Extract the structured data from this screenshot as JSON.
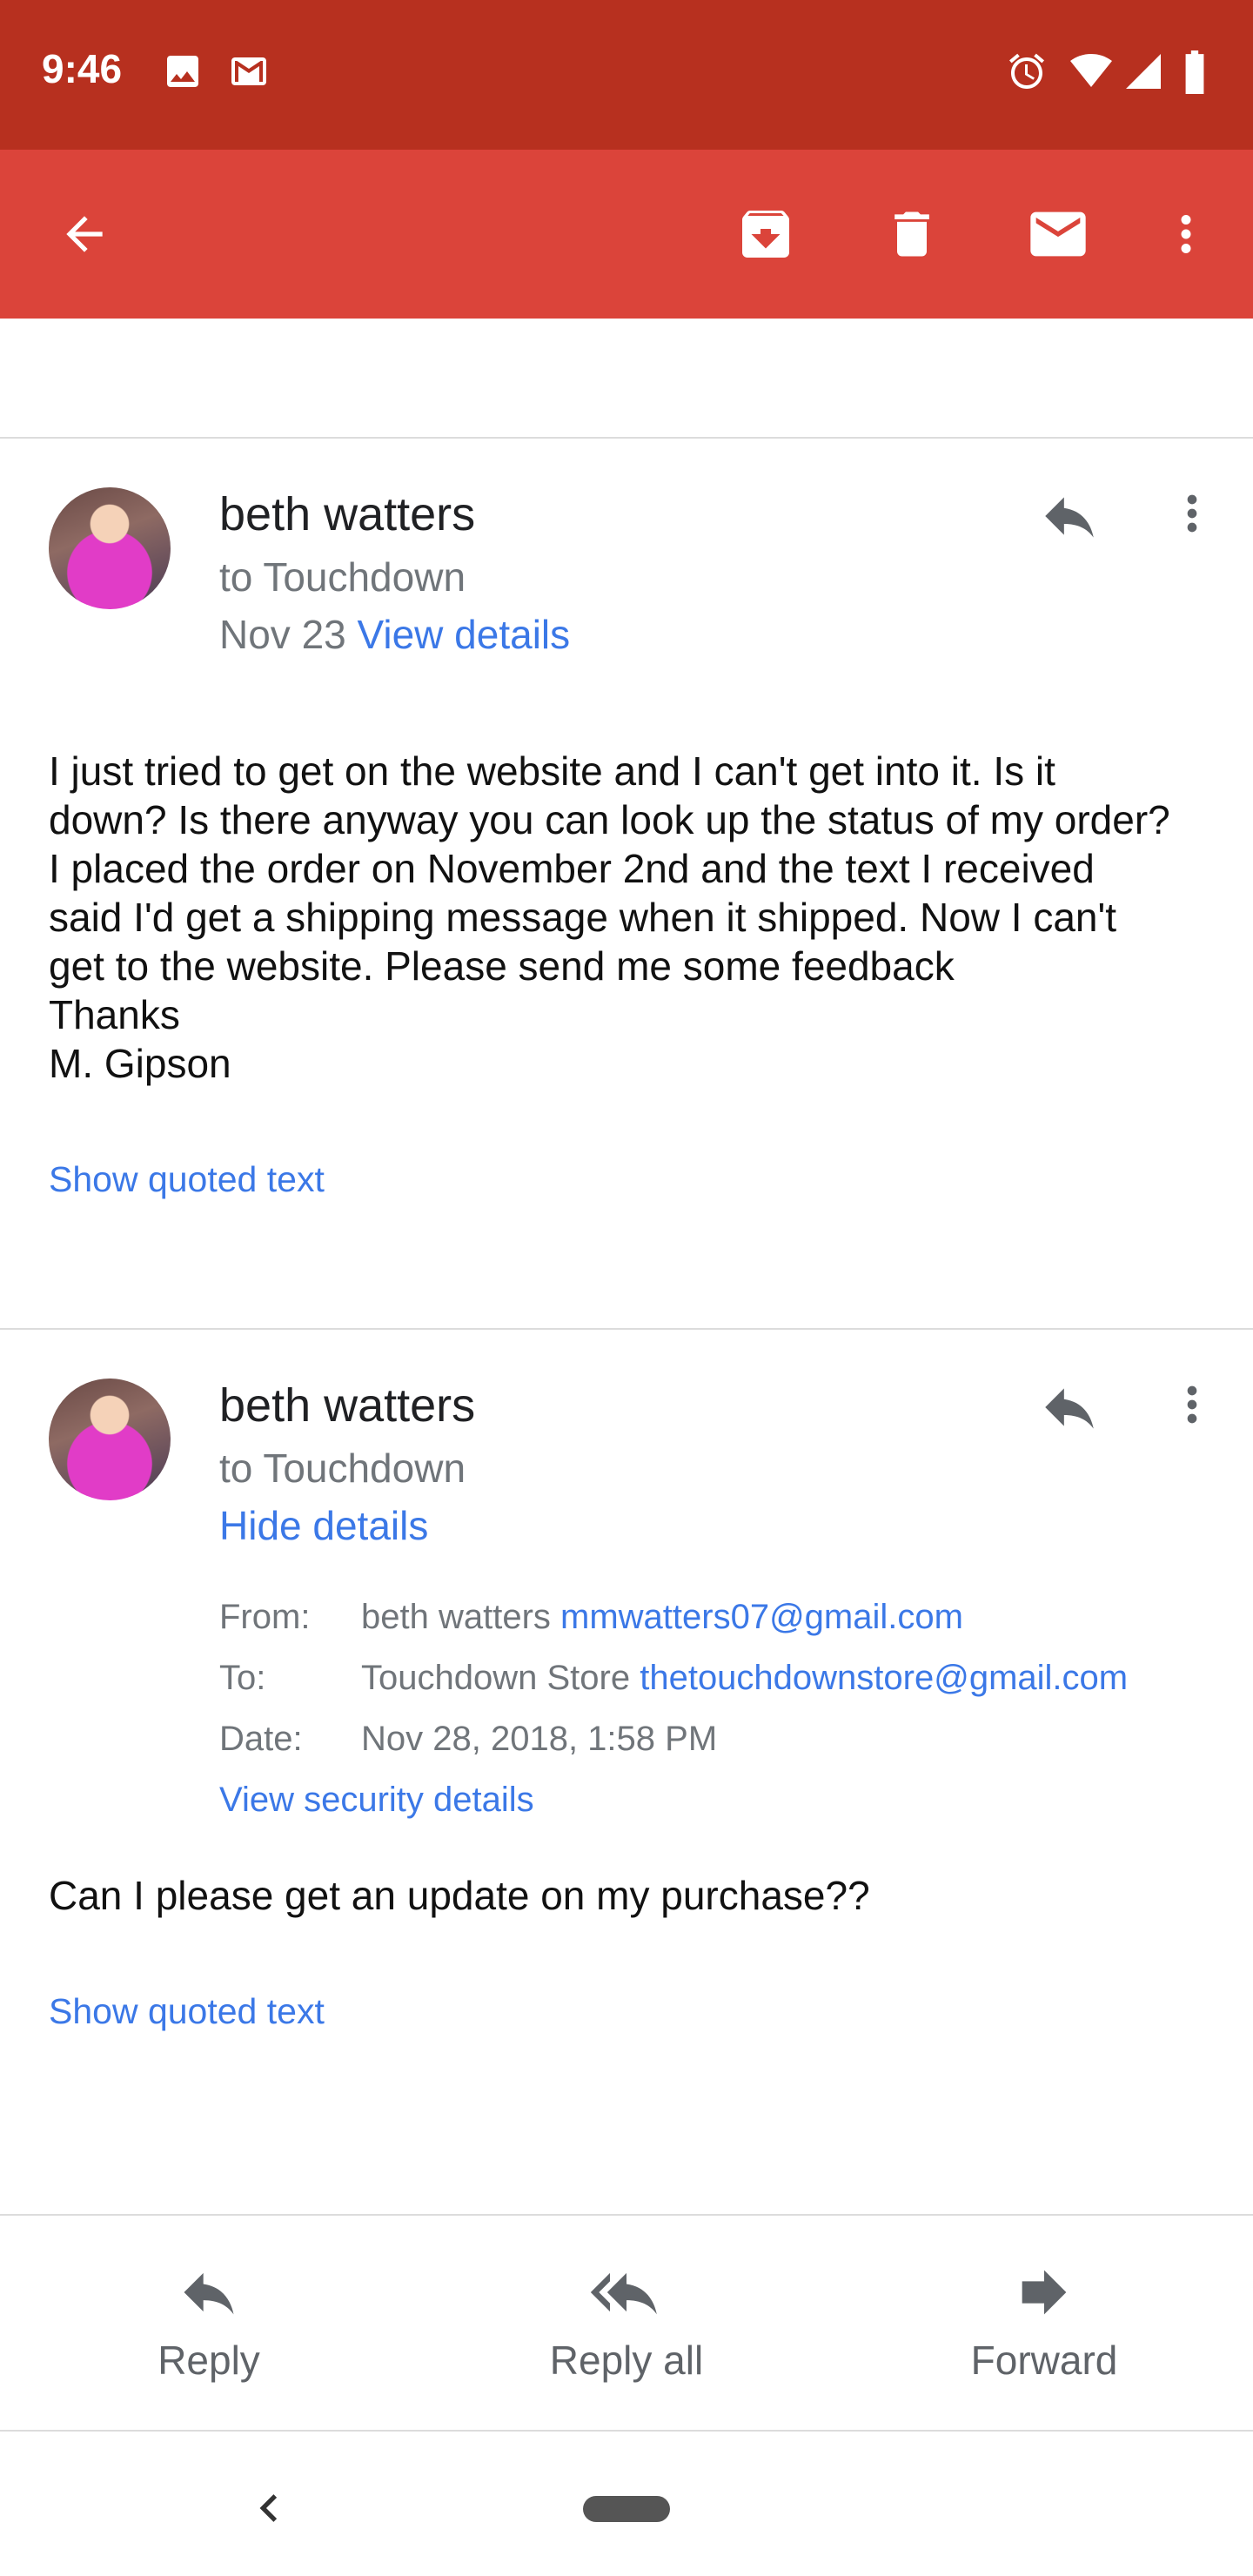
{
  "status_bar": {
    "time": "9:46",
    "icons": [
      "image-icon",
      "gmail-icon",
      "alarm-icon",
      "wifi-icon",
      "signal-icon",
      "battery-icon"
    ]
  },
  "toolbar": {
    "icons": [
      "back-arrow-icon",
      "archive-icon",
      "delete-icon",
      "mark-unread-icon",
      "more-vert-icon"
    ]
  },
  "messages": [
    {
      "sender": "beth watters",
      "recipient": "to Touchdown",
      "date": "Nov 23",
      "details_link": "View details",
      "body": "I just tried to get on the website and I can't get into it. Is it\ndown? Is there anyway you can look up the status of my order?\nI placed the order on November 2nd and the text I received\nsaid I'd get a shipping message when it shipped. Now I can't\nget to the website. Please send me some feedback\nThanks\nM. Gipson",
      "quoted_link": "Show quoted text"
    },
    {
      "sender": "beth watters",
      "recipient": "to Touchdown",
      "details_link": "Hide details",
      "details": {
        "from_label": "From:",
        "from_name": "beth watters",
        "from_email": "mmwatters07@gmail.com",
        "to_label": "To:",
        "to_name": "Touchdown Store",
        "to_email": "thetouchdownstore@gmail.com",
        "date_label": "Date:",
        "date_value": "Nov 28, 2018, 1:58 PM",
        "security_link": "View security details"
      },
      "body": "Can I please get an update on my purchase??",
      "quoted_link": "Show quoted text"
    }
  ],
  "actions": {
    "reply": "Reply",
    "reply_all": "Reply all",
    "forward": "Forward"
  },
  "colors": {
    "status_bar": "#b7301f",
    "toolbar": "#db443a",
    "link": "#3b78e7"
  }
}
